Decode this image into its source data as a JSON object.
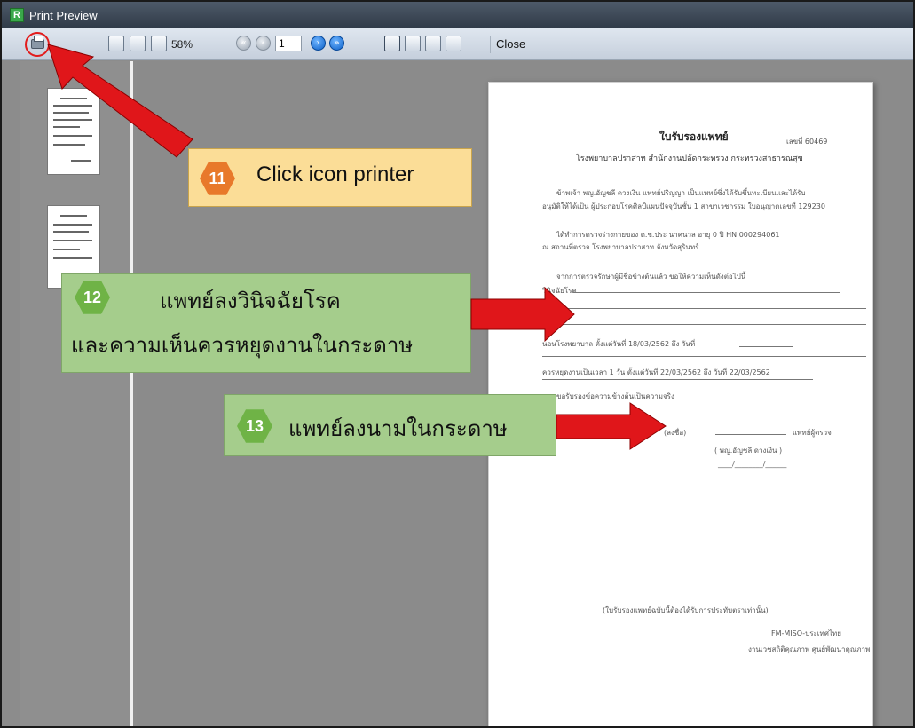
{
  "window": {
    "title": "Print Preview",
    "app_icon_letter": "R"
  },
  "toolbar": {
    "zoom": "58%",
    "page_number": "1",
    "close_label": "Close",
    "icons": [
      "printer-icon",
      "single-page-icon",
      "page-width-icon",
      "page-height-icon",
      "first-page-icon",
      "prev-page-icon",
      "next-page-icon",
      "last-page-icon",
      "one-page-view-icon",
      "two-page-view-icon",
      "four-page-view-icon",
      "multi-page-view-icon"
    ]
  },
  "callouts": {
    "step11": {
      "number": "11",
      "text": "Click icon printer"
    },
    "step12": {
      "number": "12",
      "line1": "แพทย์ลงวินิจฉัยโรค",
      "line2": "และความเห็นควรหยุดงานในกระดาษ"
    },
    "step13": {
      "number": "13",
      "text": "แพทย์ลงนามในกระดาษ"
    }
  },
  "document": {
    "title": "ใบรับรองแพทย์",
    "number": "เลขที่ 60469",
    "hospital": "โรงพยาบาลปราสาท สำนักงานปลัดกระทรวง กระทรวงสาธารณสุข",
    "para1a": "ข้าพเจ้า  พญ.อัญชลี ดวงเงิน       แพทย์ปริญญา  เป็นแพทย์ซึ่งได้รับขึ้นทะเบียนและได้รับ",
    "para1b": "อนุมัติให้ได้เป็น ผู้ประกอบโรคศิลป์แผนปัจจุบันชั้น 1 สาขาเวชกรรม  ใบอนุญาตเลขที่   129230",
    "para2a": "ได้ทำการตรวจร่างกายของ ด.ช.ประ นาคนวล                  อายุ  0   ปี HN   000294061",
    "para2b": "ณ สถานที่ตรวจ  โรงพยาบาลปราสาท  จังหวัดสุรินทร์",
    "para3": "จากการตรวจรักษาผู้มีชื่อข้างต้นแล้ว  ขอให้ความเห็นดังต่อไปนี้",
    "diagnosis_label": "วินิจฉัยโรค",
    "admit_text": "นอนโรงพยาบาล ตั้งแต่วันที่  18/03/2562    ถึง วันที่",
    "rest_text": "ควรหยุดงานเป็นเวลา    1    วัน   ตั้งแต่วันที่ 22/03/2562    ถึง วันที่  22/03/2562",
    "certify": "ขอรับรองข้อความข้างต้นเป็นความจริง",
    "sign_label": "(ลงชื่อ)",
    "examiner": "แพทย์ผู้ตรวจ",
    "sign_name": "(    พญ.อัญชลี  ดวงเงิน     )",
    "sign_date": "____/________/______",
    "footer_note": "(ใบรับรองแพทย์ฉบับนี้ต้องได้รับการประทับตราเท่านั้น)",
    "footer1": "FM-MISO-ประเทศไทย",
    "footer2": "งานเวชสถิติคุณภาพ ศูนย์พัฒนาคุณภาพ"
  },
  "colors": {
    "arrow": "#e0161a",
    "highlight_circle": "#e21c1c",
    "callout_orange_bg": "#fbdd97",
    "callout_green_bg": "#a5cd8c"
  }
}
